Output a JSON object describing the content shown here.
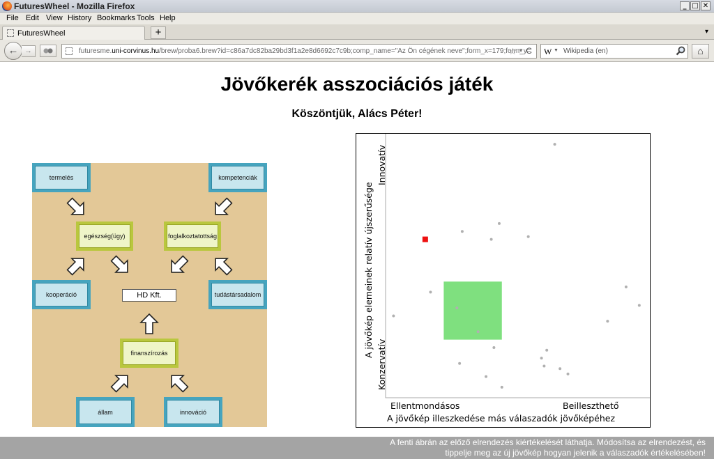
{
  "window": {
    "title": "FuturesWheel - Mozilla Firefox",
    "minimize": "_",
    "maximize": "□",
    "close": "✕"
  },
  "menu": [
    "File",
    "Edit",
    "View",
    "History",
    "Bookmarks",
    "Tools",
    "Help"
  ],
  "tab": {
    "label": "FuturesWheel",
    "newtab": "+",
    "list": "▾"
  },
  "nav": {
    "back": "←",
    "forward": "→",
    "url_prefix": "futuresme.",
    "url_domain": "uni-corvinus.hu",
    "url_rest": "/brew/proba6.brew?id=c86a7dc82ba29bd3f1a2e8d6692c7c9b;comp_name=\"Az Ön cégének neve\";form_x=179;form_y=",
    "star": "☆",
    "reload": "C",
    "search_engine": "W",
    "search_placeholder": "Wikipedia (en)",
    "home": "⌂"
  },
  "page": {
    "title": "Jövőkerék asszociációs játék",
    "greeting": "Köszöntjük, Alács Péter!",
    "footer_line1": "A fenti ábrán az előző elrendezés kiértékelését láthatja. Módosítsa az elrendezést, és",
    "footer_line2": "tippelje meg az új jövőkép hogyan jelenik a válaszadók értékelésében!"
  },
  "wheel": {
    "center": "HD Kft.",
    "nodes": {
      "termeles": "termelés",
      "kompetenciak": "kompetenciák",
      "egeszseg": "egészség(ügy)",
      "foglalkoztatottsag": "foglalkoztatottság",
      "kooperacio": "kooperáció",
      "tudastarsadalom": "tudástársadalom",
      "finanszirozas": "finanszírozás",
      "allam": "állam",
      "innovacio": "innováció"
    }
  },
  "chart_data": {
    "type": "scatter",
    "xlabel": "A jövőkép illeszkedése más válaszadók jövőképéhez",
    "ylabel": "A jövőkép elemeinek relatív újszerűsége",
    "x_low_label": "Ellentmondásos",
    "x_high_label": "Beilleszthető",
    "y_low_label": "Konzervatív",
    "y_high_label": "Innovatív",
    "xlim": [
      0,
      100
    ],
    "ylim": [
      0,
      100
    ],
    "points": [
      {
        "x": 64,
        "y": 96
      },
      {
        "x": 29,
        "y": 63
      },
      {
        "x": 43,
        "y": 66
      },
      {
        "x": 40,
        "y": 60
      },
      {
        "x": 54,
        "y": 61
      },
      {
        "x": 17,
        "y": 40
      },
      {
        "x": 27,
        "y": 34
      },
      {
        "x": 3,
        "y": 31
      },
      {
        "x": 35,
        "y": 25
      },
      {
        "x": 41,
        "y": 19
      },
      {
        "x": 28,
        "y": 13
      },
      {
        "x": 38,
        "y": 8
      },
      {
        "x": 44,
        "y": 4
      },
      {
        "x": 61,
        "y": 18
      },
      {
        "x": 59,
        "y": 15
      },
      {
        "x": 60,
        "y": 12
      },
      {
        "x": 66,
        "y": 11
      },
      {
        "x": 69,
        "y": 9
      },
      {
        "x": 84,
        "y": 29
      },
      {
        "x": 91,
        "y": 42
      },
      {
        "x": 96,
        "y": 35
      }
    ],
    "highlight": {
      "x": 15,
      "y": 60,
      "color": "#ee1111"
    },
    "target_region": {
      "x0": 22,
      "x1": 44,
      "y0": 22,
      "y1": 44,
      "color": "#7fe07f"
    },
    "point_color": "#b0b0b0"
  }
}
